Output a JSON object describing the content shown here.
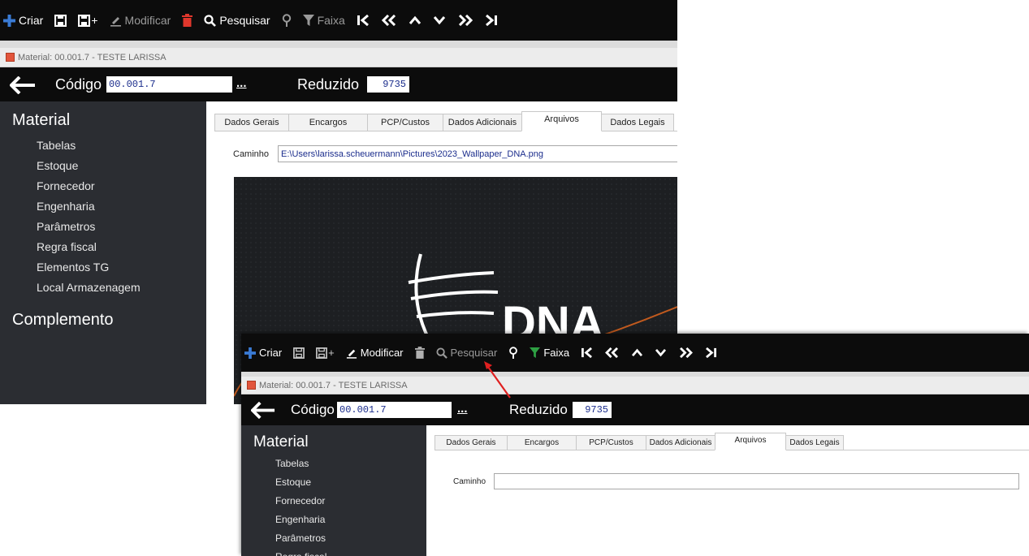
{
  "toolbar": {
    "create": "Criar",
    "save_plus": "+",
    "modify": "Modificar",
    "search": "Pesquisar",
    "range": "Faixa"
  },
  "window_title": "Material: 00.001.7 - TESTE LARISSA",
  "codebar": {
    "code_label": "Código",
    "code_value": "00.001.7",
    "dots": "...",
    "reduced_label": "Reduzido",
    "reduced_value": "9735"
  },
  "sidebar": {
    "section1": "Material",
    "items": [
      "Tabelas",
      "Estoque",
      "Fornecedor",
      "Engenharia",
      "Parâmetros",
      "Regra fiscal",
      "Elementos TG",
      "Local Armazenagem"
    ],
    "section2": "Complemento"
  },
  "tabs": [
    "Dados Gerais",
    "Encargos",
    "PCP/Custos",
    "Dados Adicionais",
    "Arquivos",
    "Dados Legais"
  ],
  "active_tab": "Arquivos",
  "path_label": "Caminho",
  "path_value_top": "E:\\Users\\larissa.scheuermann\\Pictures\\2023_Wallpaper_DNA.png",
  "path_value_bottom": "",
  "preview_text": "DNA",
  "colors": {
    "toolbar_bg": "#0c0c0c",
    "sidebar_bg": "#2b2d32",
    "accent_blue": "#3a7bd5",
    "delete_red": "#e0372c",
    "filter_green": "#2ea043",
    "annotation_arrow": "#e02020"
  }
}
